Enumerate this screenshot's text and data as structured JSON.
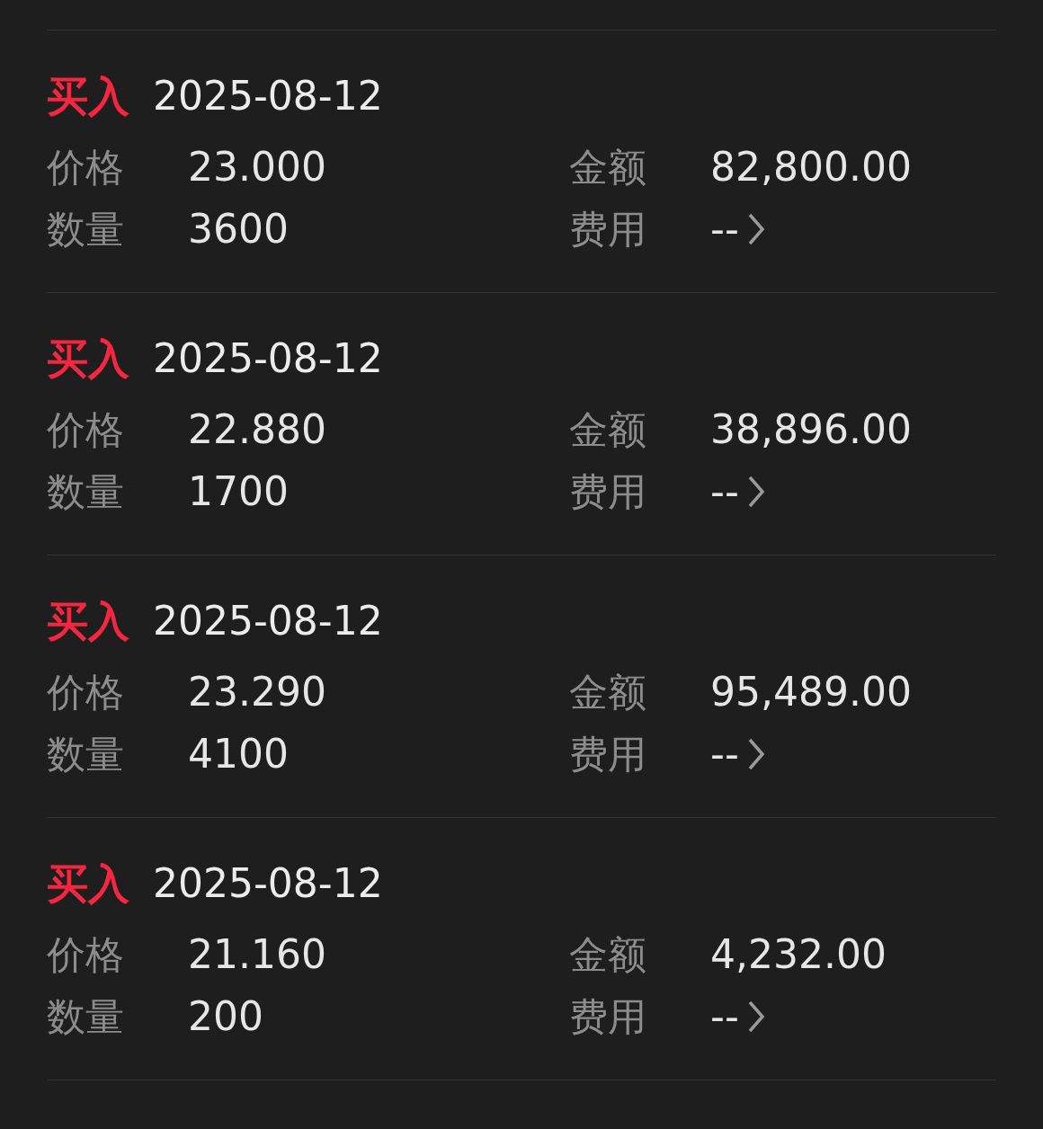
{
  "records": [
    {
      "kind": "buy",
      "action": "买入",
      "date": "2025-08-12",
      "fields": [
        {
          "label": "价格",
          "value": "23.000"
        },
        {
          "label": "金额",
          "value": "82,800.00"
        },
        {
          "label": "数量",
          "value": "3600"
        },
        {
          "label": "费用",
          "value": "--",
          "link": true
        }
      ]
    },
    {
      "kind": "buy",
      "action": "买入",
      "date": "2025-08-12",
      "fields": [
        {
          "label": "价格",
          "value": "22.880"
        },
        {
          "label": "金额",
          "value": "38,896.00"
        },
        {
          "label": "数量",
          "value": "1700"
        },
        {
          "label": "费用",
          "value": "--",
          "link": true
        }
      ]
    },
    {
      "kind": "buy",
      "action": "买入",
      "date": "2025-08-12",
      "fields": [
        {
          "label": "价格",
          "value": "23.290"
        },
        {
          "label": "金额",
          "value": "95,489.00"
        },
        {
          "label": "数量",
          "value": "4100"
        },
        {
          "label": "费用",
          "value": "--",
          "link": true
        }
      ]
    },
    {
      "kind": "buy",
      "action": "买入",
      "date": "2025-08-12",
      "fields": [
        {
          "label": "价格",
          "value": "21.160"
        },
        {
          "label": "金额",
          "value": "4,232.00"
        },
        {
          "label": "数量",
          "value": "200"
        },
        {
          "label": "费用",
          "value": "--",
          "link": true
        }
      ]
    }
  ]
}
